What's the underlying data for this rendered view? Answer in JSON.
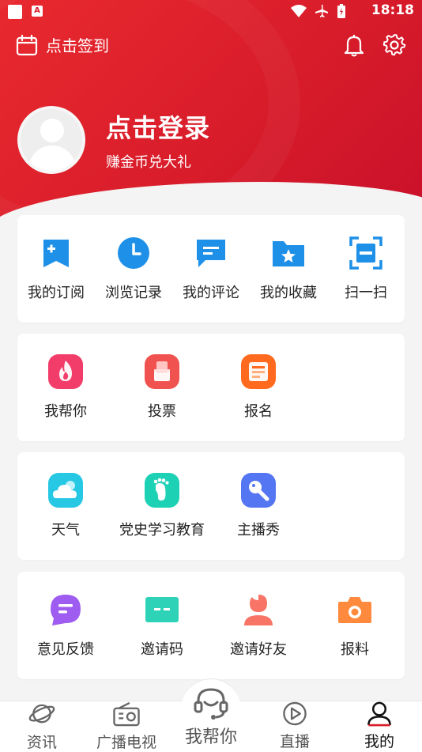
{
  "status": {
    "time": "18:18"
  },
  "header": {
    "checkin_label": "点击签到"
  },
  "profile": {
    "title": "点击登录",
    "subtitle": "赚金币兑大礼"
  },
  "row1": [
    {
      "label": "我的订阅",
      "icon": "subscribe-icon"
    },
    {
      "label": "浏览记录",
      "icon": "clock-icon"
    },
    {
      "label": "我的评论",
      "icon": "comment-icon"
    },
    {
      "label": "我的收藏",
      "icon": "favorite-folder-icon"
    },
    {
      "label": "扫一扫",
      "icon": "scan-icon"
    }
  ],
  "row2": [
    {
      "label": "我帮你",
      "icon": "flame-icon"
    },
    {
      "label": "投票",
      "icon": "vote-icon"
    },
    {
      "label": "报名",
      "icon": "signup-icon"
    }
  ],
  "row3": [
    {
      "label": "天气",
      "icon": "weather-icon"
    },
    {
      "label": "党史学习教育",
      "icon": "footprint-icon"
    },
    {
      "label": "主播秀",
      "icon": "microphone-icon"
    }
  ],
  "row4": [
    {
      "label": "意见反馈",
      "icon": "feedback-icon"
    },
    {
      "label": "邀请码",
      "icon": "invite-code-icon"
    },
    {
      "label": "邀请好友",
      "icon": "invite-friend-icon"
    },
    {
      "label": "报料",
      "icon": "camera-icon"
    }
  ],
  "tabs": [
    {
      "label": "资讯",
      "icon": "planet-icon"
    },
    {
      "label": "广播电视",
      "icon": "radio-icon"
    },
    {
      "label": "我帮你",
      "icon": "headset-icon"
    },
    {
      "label": "直播",
      "icon": "play-icon"
    },
    {
      "label": "我的",
      "icon": "user-icon"
    }
  ],
  "colors": {
    "brand_red": "#d81c2a",
    "active_tab": "#111111"
  }
}
